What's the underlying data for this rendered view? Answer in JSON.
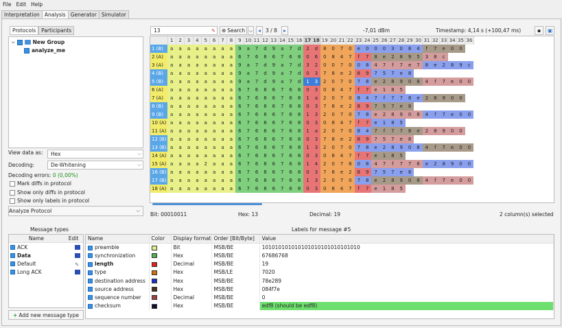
{
  "menu": [
    "File",
    "Edit",
    "Help"
  ],
  "tabs": [
    "Interpretation",
    "Analysis",
    "Generator",
    "Simulator"
  ],
  "subtabs": [
    "Protocols",
    "Participants"
  ],
  "tree": {
    "group": "New Group",
    "item": "analyze_me"
  },
  "left": {
    "view_label": "View data as:",
    "view_value": "Hex",
    "decoding_label": "Decoding:",
    "decoding_value": "De-Whitening",
    "errors_label": "Decoding errors:",
    "errors_value": "0 (0,00%)",
    "chk1": "Mark diffs in protocol",
    "chk2": "Show only diffs in protocol",
    "chk3": "Show only labels in protocol",
    "analyze": "Analyze Protocol"
  },
  "toolbar": {
    "search_value": "13",
    "search_btn": "Search",
    "page": "3 / 8",
    "rssi": "-7,01 dBm",
    "timestamp": "Timestamp: 4,14 s (+100,47 ms)"
  },
  "status": {
    "bit": "Bit:  00010011",
    "hex": "Hex:  13",
    "decimal": "Decimal:  19",
    "selected": "2 column(s) selected"
  },
  "colors": {
    "preamble": "#e8f08a",
    "sync": "#7fcf7f",
    "length": "#e87575",
    "type": "#f0a55a",
    "dest": "#8aa0ee",
    "source": "#a79a89",
    "seq": "#d49c9c",
    "checksum": "#6edf6e",
    "rowhl": "#5aa7e8"
  },
  "grid_rows": [
    {
      "label": "1 (B)",
      "blue": true,
      "vals": "aaaaaaaa9a7d9a7d2d8070e0003084f7e00",
      "len": 33
    },
    {
      "label": "2 (A)",
      "blue": false,
      "vals": "aaaaaaaa67686768060847f78e289538c",
      "len": 33
    },
    {
      "label": "3 (A)",
      "blue": false,
      "vals": "aaaaaaaa9a7d9a7d3200700847f7e78e289c0",
      "len": 35
    },
    {
      "label": "4 (B)",
      "blue": true,
      "vals": "aaaaaaaa9a7d9a7d037 8e289757e8",
      "len": 30
    },
    {
      "label": "5 (B)",
      "blue": true,
      "vals": "aaaaaaaa9a7d9a7d13207078e28908 4f7e00",
      "len": 35
    },
    {
      "label": "6 (A)",
      "blue": false,
      "vals": "aaaaaaaa67686768030847f7e185",
      "len": 29
    },
    {
      "label": "7 (A)",
      "blue": false,
      "vals": "aaaaaaaa676867681a20708 47f778e28900",
      "len": 35
    },
    {
      "label": "8 (B)",
      "blue": true,
      "vals": "aaaaaaaa6768676803 78e289757e8",
      "len": 30
    },
    {
      "label": "9 (B)",
      "blue": true,
      "vals": "aaaaaaaa676867681320707 8e289084f7e00",
      "len": 35
    },
    {
      "label": "10 (A)",
      "blue": false,
      "vals": "aaaaaaaa67686768030847f7e185",
      "len": 29
    },
    {
      "label": "11 (A)",
      "blue": false,
      "vals": "aaaaaaaa676867681a207084 7f778e28900",
      "len": 35
    },
    {
      "label": "12 (B)",
      "blue": true,
      "vals": "aaaaaaaa6768676803 78e289757e8",
      "len": 30
    },
    {
      "label": "13 (B)",
      "blue": true,
      "vals": "aaaaaaaa67686768132070 78e289084f7e00",
      "len": 35
    },
    {
      "label": "14 (A)",
      "blue": false,
      "vals": "aaaaaaaa67686768030847f7e185",
      "len": 29
    },
    {
      "label": "15 (A)",
      "blue": false,
      "vals": "aaaa2aaa67686768142078084 7f778e28900",
      "len": 35
    },
    {
      "label": "16 (B)",
      "blue": true,
      "vals": "aaaaaaaa6768676803 78e289757e8",
      "len": 30
    },
    {
      "label": "17 (B)",
      "blue": true,
      "vals": "aaaaaaaa67686768132070 78e289084f7e00",
      "len": 35
    },
    {
      "label": "18 (A)",
      "blue": false,
      "vals": "aaaaaaaa67686768030847f7e185",
      "len": 29
    }
  ],
  "msgtypes": {
    "title": "Message types",
    "col_name": "Name",
    "col_edit": "Edit",
    "items": [
      "ACK",
      "Data",
      "Default",
      "Long ACK"
    ],
    "add": "Add new message type"
  },
  "labels": {
    "title": "Labels for message #5",
    "headers": [
      "Name",
      "Color",
      "Display format",
      "Order [Bit/Byte]",
      "Value"
    ],
    "rows": [
      {
        "name": "preamble",
        "color": "#e8f08a",
        "fmt": "Bit",
        "order": "MSB/BE",
        "value": "101010101010101010101010101010"
      },
      {
        "name": "synchronization",
        "color": "#4caf50",
        "fmt": "Hex",
        "order": "MSB/BE",
        "value": "67686768"
      },
      {
        "name": "length",
        "color": "#e02020",
        "fmt": "Decimal",
        "order": "MSB/BE",
        "value": "19"
      },
      {
        "name": "type",
        "color": "#d07010",
        "fmt": "Hex",
        "order": "MSB/LE",
        "value": "7020"
      },
      {
        "name": "destination address",
        "color": "#2030c0",
        "fmt": "Hex",
        "order": "MSB/BE",
        "value": "78e289"
      },
      {
        "name": "source address",
        "color": "#4a3020",
        "fmt": "Hex",
        "order": "MSB/BE",
        "value": "084f7e"
      },
      {
        "name": "sequence number",
        "color": "#a04040",
        "fmt": "Decimal",
        "order": "MSB/BE",
        "value": "0"
      },
      {
        "name": "checksum",
        "color": "#101030",
        "fmt": "Hex",
        "order": "MSB/BE",
        "value": "edf8 (should be edf8)"
      }
    ]
  }
}
